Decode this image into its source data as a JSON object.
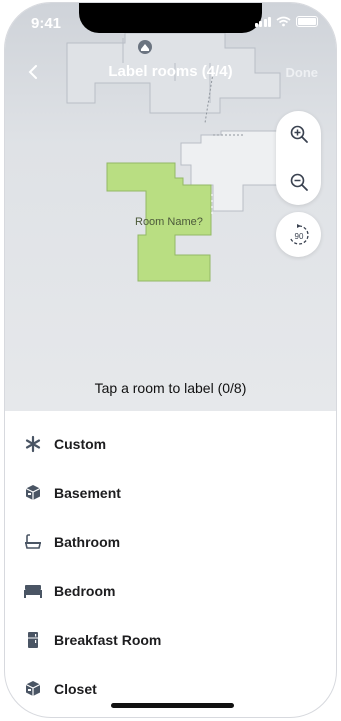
{
  "status_bar": {
    "time": "9:41"
  },
  "nav": {
    "title": "Label rooms (4/4)",
    "done_label": "Done"
  },
  "map": {
    "room_placeholder": "Room Name?",
    "selected_room_color": "#b9de82",
    "zoom_in_icon": "zoom-in-icon",
    "zoom_out_icon": "zoom-out-icon",
    "rotate_label": "90"
  },
  "hint": {
    "text": "Tap a room to label (0/8)"
  },
  "room_types": [
    {
      "label": "Custom",
      "icon": "asterisk-icon"
    },
    {
      "label": "Basement",
      "icon": "cube-icon"
    },
    {
      "label": "Bathroom",
      "icon": "bathtub-icon"
    },
    {
      "label": "Bedroom",
      "icon": "bed-icon"
    },
    {
      "label": "Breakfast Room",
      "icon": "refrigerator-icon"
    },
    {
      "label": "Closet",
      "icon": "cube-icon"
    }
  ]
}
